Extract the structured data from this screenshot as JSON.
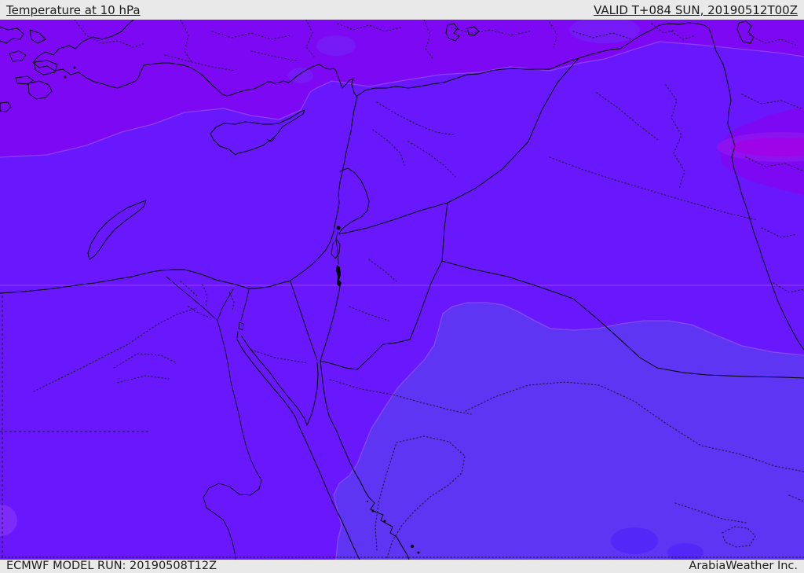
{
  "header": {
    "title": "Temperature at 10 hPa",
    "valid_label": "VALID T+084 SUN, 20190512T00Z"
  },
  "footer": {
    "model_run": "ECMWF MODEL RUN: 20190508T12Z",
    "credit": "ArabiaWeather Inc."
  },
  "map": {
    "description": "ECMWF 10 hPa temperature shaded forecast map over the Middle East",
    "colors": {
      "bar_bg": "#e9e9e9",
      "bar_text": "#1c1c1c",
      "band_violet": "#7d08f3",
      "band_blue": "#6917fd",
      "band_light": "#5d35f2",
      "band_deep": "#5327f7",
      "blob_magenta": "#9d05e8",
      "blob_magenta_halo": "#8d12f0",
      "turkey_blob": "#7519f6",
      "corner_blob": "#7d2bfa",
      "edge_line": "#a76ef8",
      "gridline_pink": "#ff9ce8",
      "line_black": "#000000",
      "admin_dots": "#1a1833"
    }
  }
}
